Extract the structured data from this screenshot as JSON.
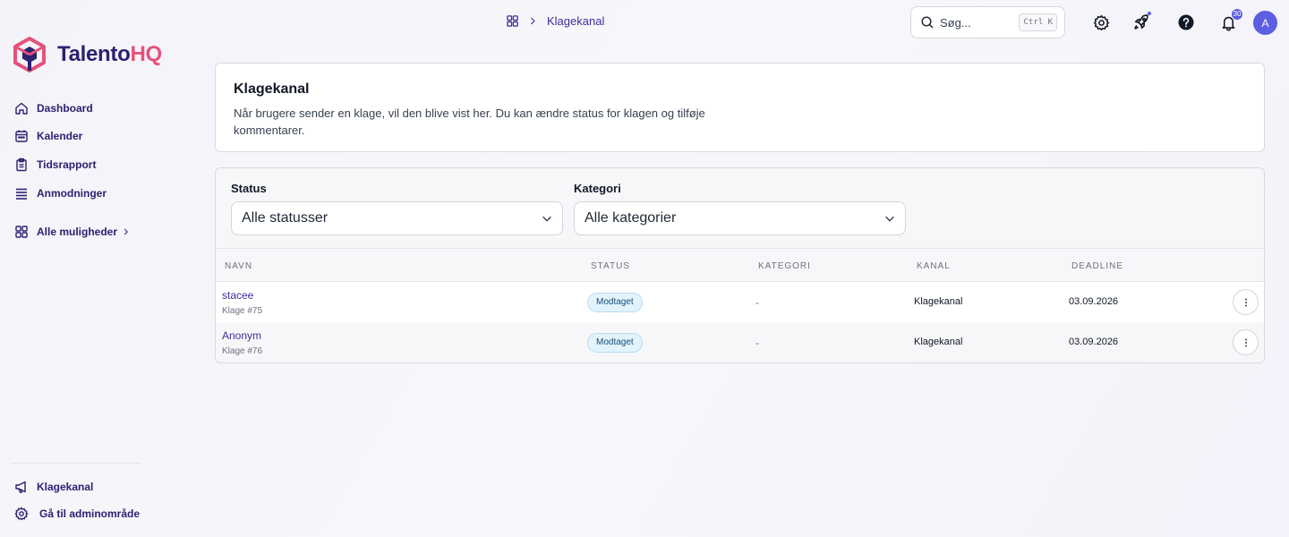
{
  "app": {
    "brand_part1": "Talento",
    "brand_part2": "HQ"
  },
  "sidebar": {
    "items": [
      {
        "label": "Dashboard",
        "icon": "home-icon"
      },
      {
        "label": "Kalender",
        "icon": "calendar-icon"
      },
      {
        "label": "Tidsrapport",
        "icon": "clipboard-icon"
      },
      {
        "label": "Anmodninger",
        "icon": "list-icon"
      },
      {
        "label": "Alle muligheder",
        "icon": "grid-icon"
      }
    ],
    "bottom": [
      {
        "label": "Klagekanal",
        "icon": "megaphone-icon"
      },
      {
        "label": "Gå til adminområde",
        "icon": "gear-icon"
      }
    ]
  },
  "header": {
    "breadcrumb": "Klagekanal",
    "search_label": "Søg...",
    "search_shortcut": "Ctrl K",
    "notification_count": "30",
    "avatar_initial": "A"
  },
  "intro": {
    "title": "Klagekanal",
    "description": "Når brugere sender en klage, vil den blive vist her. Du kan ændre status for klagen og tilføje kommentarer."
  },
  "filters": {
    "status_label": "Status",
    "status_value": "Alle statusser",
    "category_label": "Kategori",
    "category_value": "Alle kategorier"
  },
  "table": {
    "columns": [
      "NAVN",
      "STATUS",
      "KATEGORI",
      "KANAL",
      "DEADLINE"
    ],
    "rows": [
      {
        "name": "stacee",
        "sub": "Klage #75",
        "status": "Modtaget",
        "category": "-",
        "channel": "Klagekanal",
        "deadline": "03.09.2026"
      },
      {
        "name": "Anonym",
        "sub": "Klage #76",
        "status": "Modtaget",
        "category": "-",
        "channel": "Klagekanal",
        "deadline": "03.09.2026"
      }
    ]
  },
  "colors": {
    "brand_navy": "#2b2270",
    "brand_pink": "#e4527a",
    "accent": "#5b5fe0"
  }
}
